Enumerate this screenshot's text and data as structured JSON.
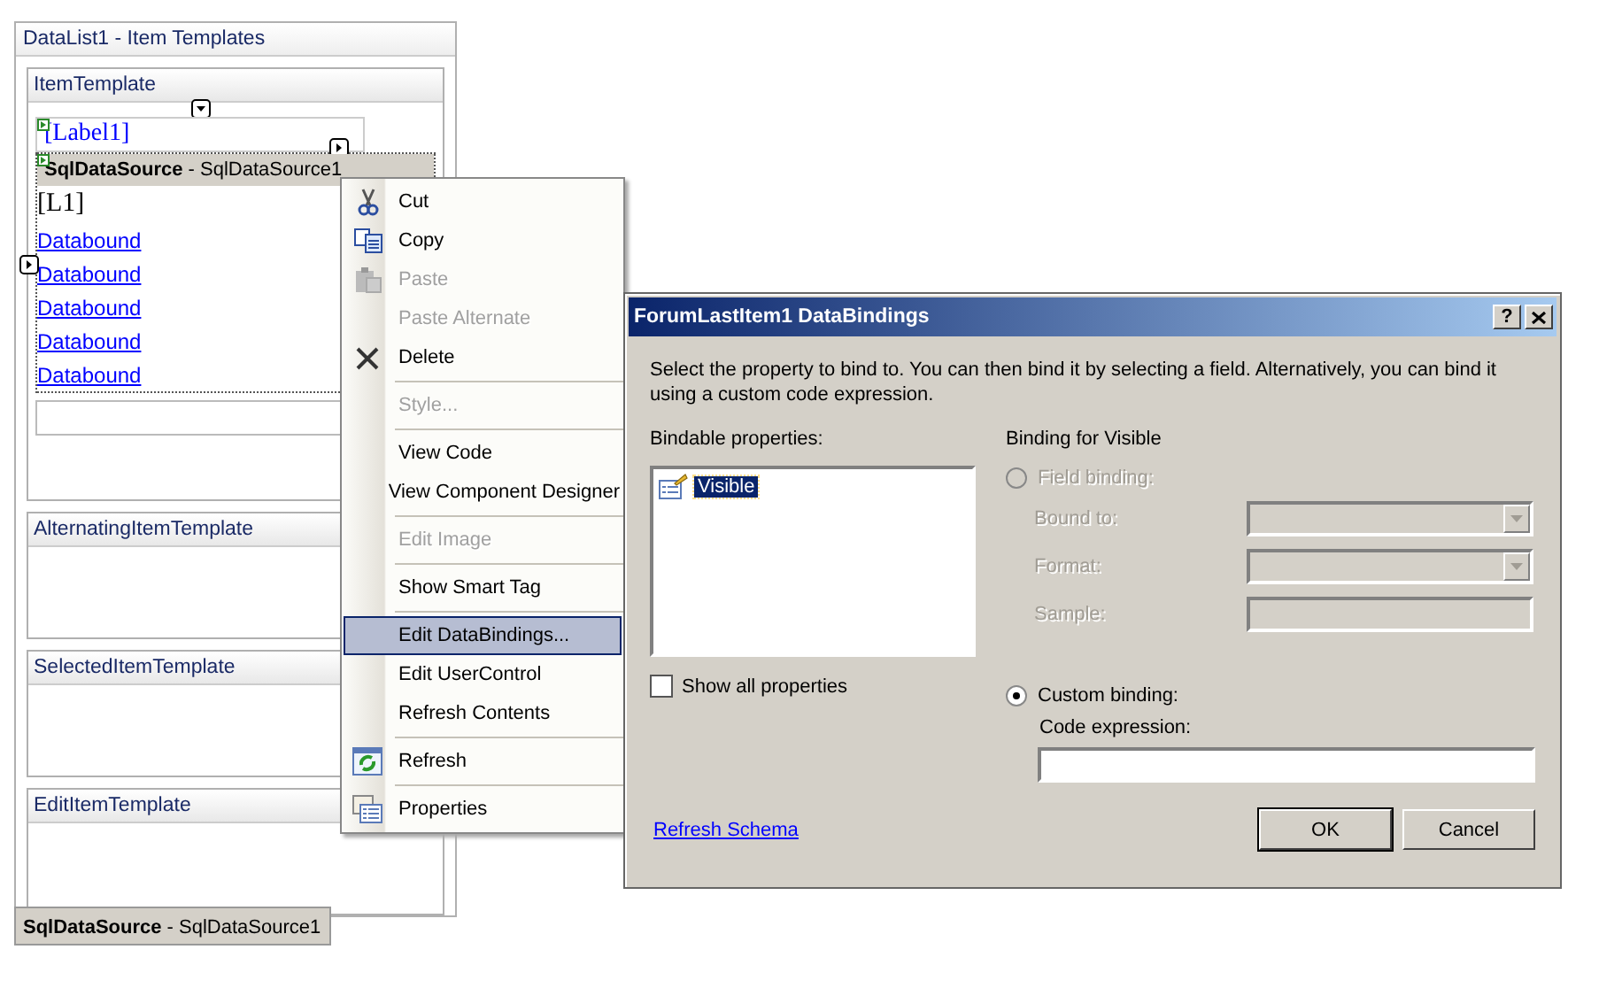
{
  "designer": {
    "title": "DataList1 - Item Templates",
    "templates": [
      {
        "header": "ItemTemplate",
        "kind": "item",
        "label": "[Label1]",
        "datasource": {
          "type": "SqlDataSource",
          "name": " - SqlDataSource1"
        },
        "field": "[L1]",
        "links": [
          "Databound",
          "Databound",
          "Databound",
          "Databound",
          "Databound"
        ]
      },
      {
        "header": "AlternatingItemTemplate",
        "kind": "empty"
      },
      {
        "header": "SelectedItemTemplate",
        "kind": "empty"
      },
      {
        "header": "EditItemTemplate",
        "kind": "empty"
      }
    ],
    "tray": {
      "type": "SqlDataSource",
      "name": " - SqlDataSource1"
    }
  },
  "context_menu": [
    {
      "label": "Cut",
      "kind": "cut",
      "disabled": false,
      "selected": false
    },
    {
      "label": "Copy",
      "kind": "copy",
      "disabled": false,
      "selected": false
    },
    {
      "label": "Paste",
      "kind": "paste",
      "disabled": true,
      "selected": false
    },
    {
      "label": "Paste Alternate",
      "disabled": true,
      "selected": false
    },
    {
      "label": "Delete",
      "kind": "delete",
      "disabled": false,
      "selected": false
    },
    {
      "kind": "separator"
    },
    {
      "label": "Style...",
      "disabled": true,
      "selected": false
    },
    {
      "kind": "separator"
    },
    {
      "label": "View Code",
      "disabled": false,
      "selected": false
    },
    {
      "label": "View Component Designer",
      "disabled": false,
      "selected": false
    },
    {
      "kind": "separator"
    },
    {
      "label": "Edit Image",
      "disabled": true,
      "selected": false
    },
    {
      "kind": "separator"
    },
    {
      "label": "Show Smart Tag",
      "disabled": false,
      "selected": false
    },
    {
      "kind": "separator"
    },
    {
      "label": "Edit DataBindings...",
      "disabled": false,
      "selected": true
    },
    {
      "label": "Edit UserControl",
      "disabled": false,
      "selected": false
    },
    {
      "label": "Refresh Contents",
      "disabled": false,
      "selected": false
    },
    {
      "kind": "separator"
    },
    {
      "label": "Refresh",
      "kind": "refresh",
      "disabled": false,
      "selected": false
    },
    {
      "kind": "separator"
    },
    {
      "label": "Properties",
      "kind": "properties",
      "disabled": false,
      "selected": false
    }
  ],
  "dialog": {
    "title": "ForumLastItem1 DataBindings",
    "help_button": "?",
    "description": "Select the property to bind to. You can then bind it by selecting a field. Alternatively, you can bind it using a custom code expression.",
    "bindable_label": "Bindable properties:",
    "properties": [
      {
        "label": "Visible",
        "selected": true
      }
    ],
    "show_all": {
      "label": "Show all properties",
      "checked": false
    },
    "binding_title": "Binding for Visible",
    "field_binding": {
      "label": "Field binding:",
      "selected": false,
      "disabled": true
    },
    "fields": [
      {
        "label": "Bound to:",
        "kind": "dropdown"
      },
      {
        "label": "Format:",
        "kind": "dropdown"
      },
      {
        "label": "Sample:",
        "kind": "text"
      }
    ],
    "custom_binding": {
      "label": "Custom binding:",
      "selected": true,
      "disabled": false
    },
    "code_label": "Code expression:",
    "link": "Refresh Schema",
    "buttons": [
      {
        "label": "OK",
        "default": true
      },
      {
        "label": "Cancel",
        "default": false
      }
    ]
  }
}
